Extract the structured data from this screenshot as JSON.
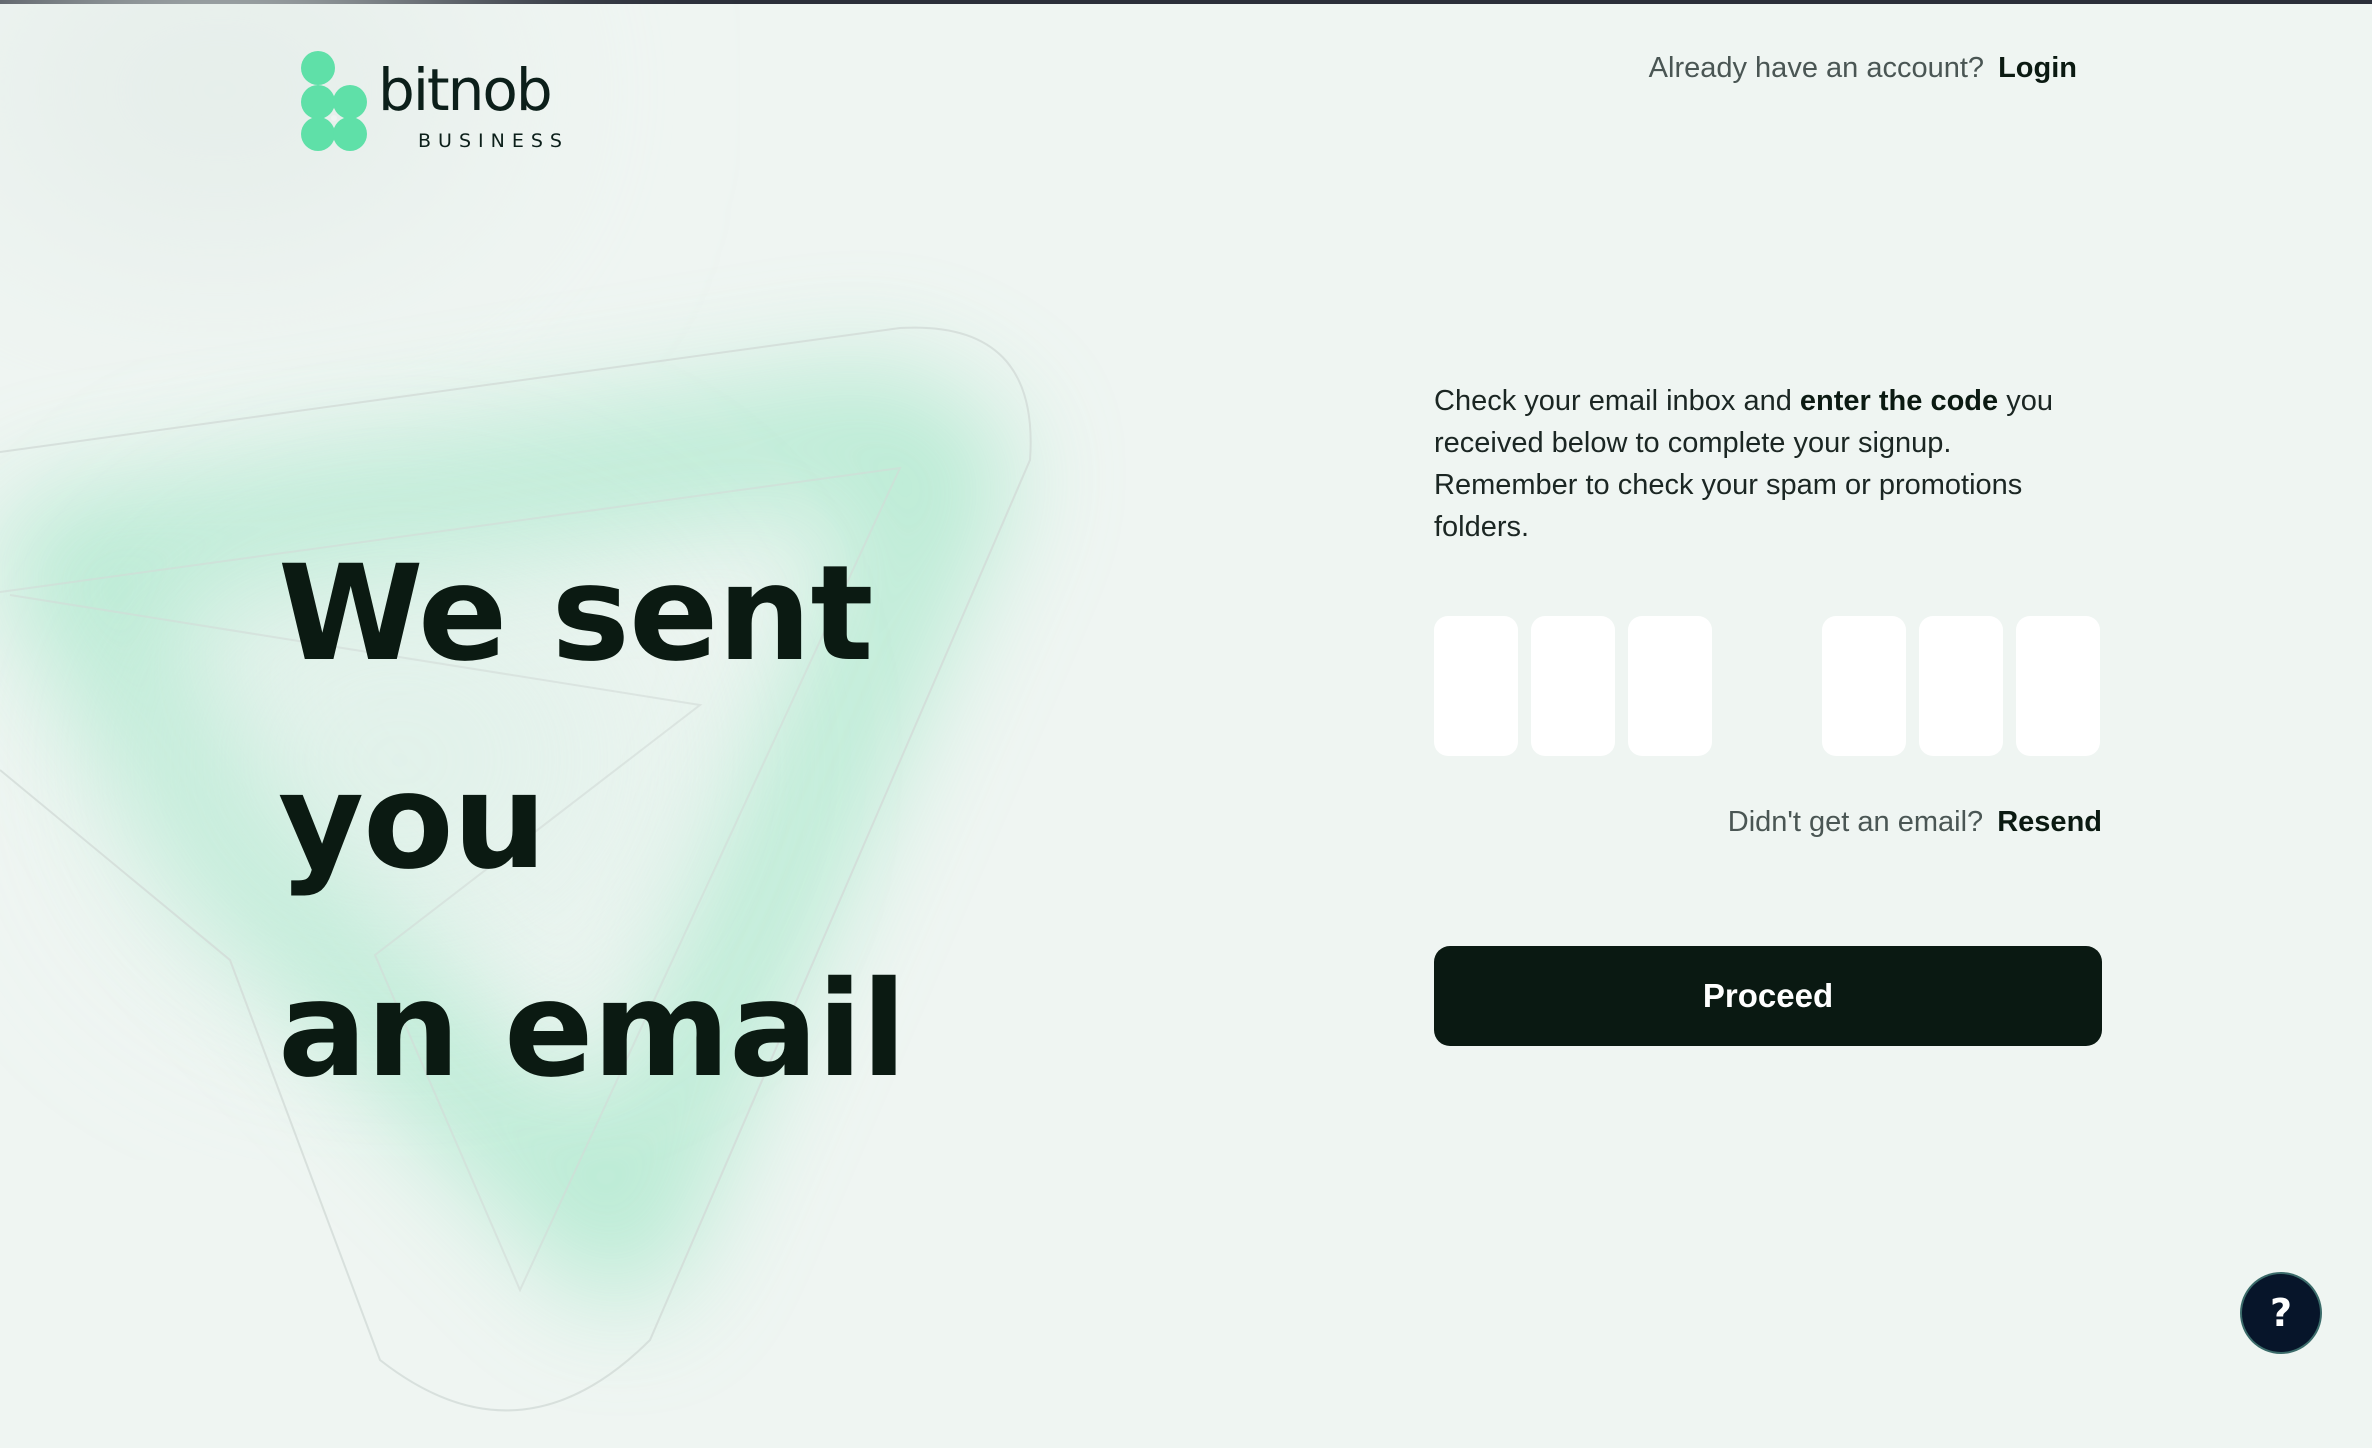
{
  "brand": {
    "name": "bitnob",
    "subtitle": "BUSINESS",
    "accent": "#5fe0a8"
  },
  "header": {
    "login_prompt": "Already have an account?",
    "login_label": "Login"
  },
  "hero": {
    "line1": "We sent you",
    "line2": "an email"
  },
  "verify": {
    "text_before": "Check your email inbox and",
    "text_bold": "enter the code",
    "text_after": "you received below to complete your signup. Remember to check your spam or promotions folders.",
    "otp_values": [
      "",
      "",
      "",
      "",
      "",
      ""
    ],
    "resend_prompt": "Didn't get an email?",
    "resend_label": "Resend",
    "proceed_label": "Proceed"
  },
  "help": {
    "label": "?"
  },
  "colors": {
    "background": "#eff5f2",
    "button": "#0a1912",
    "help_button": "#07152a",
    "glow": "#8fe3bd"
  }
}
